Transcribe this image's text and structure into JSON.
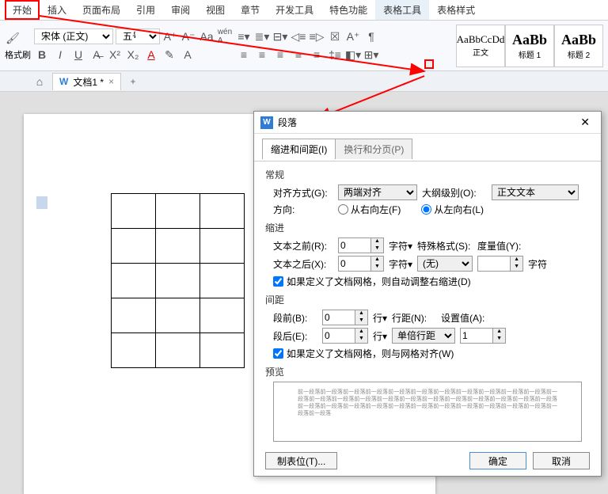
{
  "ribbon": {
    "tabs": [
      "开始",
      "插入",
      "页面布局",
      "引用",
      "审阅",
      "视图",
      "章节",
      "开发工具",
      "特色功能",
      "表格工具",
      "表格样式"
    ],
    "active_tab": "表格工具",
    "highlighted_tab": "开始",
    "format_painter": "格式刷",
    "font_name": "宋体 (正文)",
    "font_size": "五号",
    "styles": [
      {
        "preview": "AaBbCcDd",
        "name": "正文"
      },
      {
        "preview": "AaBb",
        "name": "标题 1"
      },
      {
        "preview": "AaBb",
        "name": "标题 2"
      }
    ]
  },
  "doc_tab": {
    "name": "文档1 *",
    "icon": "W"
  },
  "dialog": {
    "title": "段落",
    "tabs": {
      "indent": "缩进和间距(I)",
      "pagebreak": "换行和分页(P)"
    },
    "general": {
      "label": "常规",
      "align_label": "对齐方式(G):",
      "align_value": "两端对齐",
      "outline_label": "大纲级别(O):",
      "outline_value": "正文文本",
      "direction_label": "方向:",
      "rtl": "从右向左(F)",
      "ltr": "从左向右(L)"
    },
    "indent": {
      "label": "缩进",
      "before_label": "文本之前(R):",
      "before_value": "0",
      "unit1": "字符▾",
      "after_label": "文本之后(X):",
      "after_value": "0",
      "unit2": "字符▾",
      "special_label": "特殊格式(S):",
      "special_value": "(无)",
      "measure_label": "度量值(Y):",
      "measure_unit": "字符",
      "check": "如果定义了文档网格，则自动调整右缩进(D)"
    },
    "spacing": {
      "label": "间距",
      "before_label": "段前(B):",
      "before_value": "0",
      "unit": "行▾",
      "after_label": "段后(E):",
      "after_value": "0",
      "line_label": "行距(N):",
      "line_value": "单倍行距",
      "set_label": "设置值(A):",
      "set_value": "1",
      "check": "如果定义了文档网格，则与网格对齐(W)"
    },
    "preview_label": "预览",
    "preview_text": "前一段落前一段落前一段落前一段落前一段落前一段落前一段落前一段落前一段落前一段落前一段落前一段落前一段落前一段落前一段落前一段落前一段落前一段落前一段落前一段落前一段落前一段落前一段落前一段落前一段落前一段落前一段落前一段落前一段落前一段落前一段落前一段落前一段落前一段落前一段落前一段落",
    "tabstops": "制表位(T)...",
    "ok": "确定",
    "cancel": "取消"
  }
}
